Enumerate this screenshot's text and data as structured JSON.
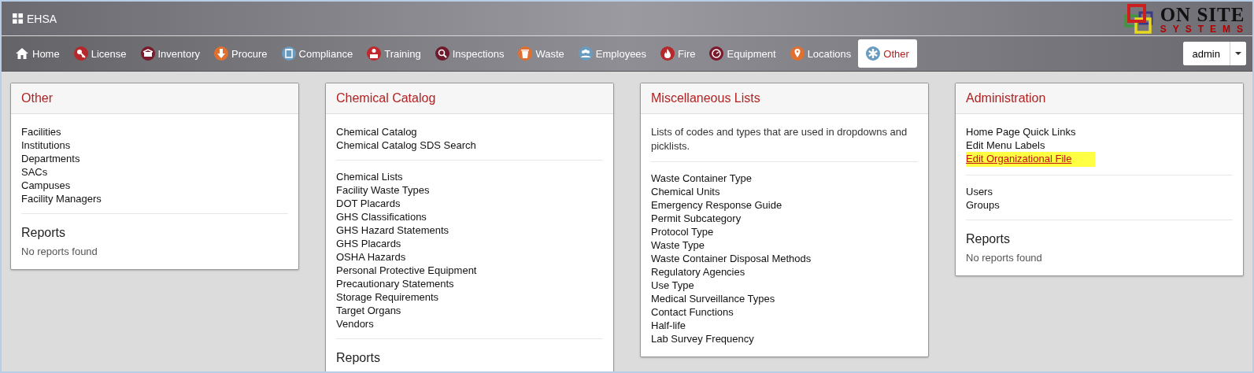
{
  "app": {
    "title": "EHSA"
  },
  "logo": {
    "line_1": "ON SITE",
    "line_2": "SYSTEMS"
  },
  "nav": [
    {
      "label": "Home",
      "color": "#ffffff",
      "selected": false
    },
    {
      "label": "License",
      "color": "#b5282b",
      "selected": false
    },
    {
      "label": "Inventory",
      "color": "#7a1a2c",
      "selected": false
    },
    {
      "label": "Procure",
      "color": "#e07030",
      "selected": false
    },
    {
      "label": "Compliance",
      "color": "#6a9cc0",
      "selected": false
    },
    {
      "label": "Training",
      "color": "#c0282e",
      "selected": false
    },
    {
      "label": "Inspections",
      "color": "#6e1a2c",
      "selected": false
    },
    {
      "label": "Waste",
      "color": "#e07030",
      "selected": false
    },
    {
      "label": "Employees",
      "color": "#6a9cc0",
      "selected": false
    },
    {
      "label": "Fire",
      "color": "#b5282b",
      "selected": false
    },
    {
      "label": "Equipment",
      "color": "#7a1a2c",
      "selected": false
    },
    {
      "label": "Locations",
      "color": "#e07030",
      "selected": false
    },
    {
      "label": "Other",
      "color": "#6a9cc0",
      "selected": true
    }
  ],
  "user_menu": {
    "label": "admin"
  },
  "panels": [
    {
      "title": "Other",
      "blocks": [
        {
          "kind": "links",
          "items": [
            {
              "label": "Facilities",
              "highlighted": false
            },
            {
              "label": "Institutions",
              "highlighted": false
            },
            {
              "label": "Departments",
              "highlighted": false
            },
            {
              "label": "SACs",
              "highlighted": false
            },
            {
              "label": "Campuses",
              "highlighted": false
            },
            {
              "label": "Facility Managers",
              "highlighted": false
            }
          ]
        },
        {
          "kind": "heading",
          "text": "Reports"
        },
        {
          "kind": "note",
          "text": "No reports found"
        }
      ]
    },
    {
      "title": "Chemical Catalog",
      "blocks": [
        {
          "kind": "links",
          "items": [
            {
              "label": "Chemical Catalog",
              "highlighted": false
            },
            {
              "label": "Chemical Catalog SDS Search",
              "highlighted": false
            }
          ]
        },
        {
          "kind": "links",
          "items": [
            {
              "label": "Chemical Lists",
              "highlighted": false
            },
            {
              "label": "Facility Waste Types",
              "highlighted": false
            },
            {
              "label": "DOT Placards",
              "highlighted": false
            },
            {
              "label": "GHS Classifications",
              "highlighted": false
            },
            {
              "label": "GHS Hazard Statements",
              "highlighted": false
            },
            {
              "label": "GHS Placards",
              "highlighted": false
            },
            {
              "label": "OSHA Hazards",
              "highlighted": false
            },
            {
              "label": "Personal Protective Equipment",
              "highlighted": false
            },
            {
              "label": "Precautionary Statements",
              "highlighted": false
            },
            {
              "label": "Storage Requirements",
              "highlighted": false
            },
            {
              "label": "Target Organs",
              "highlighted": false
            },
            {
              "label": "Vendors",
              "highlighted": false
            }
          ]
        },
        {
          "kind": "heading",
          "text": "Reports"
        }
      ]
    },
    {
      "title": "Miscellaneous Lists",
      "blocks": [
        {
          "kind": "description",
          "text": "Lists of codes and types that are used in dropdowns and picklists."
        },
        {
          "kind": "links",
          "items": [
            {
              "label": "Waste Container Type",
              "highlighted": false
            },
            {
              "label": "Chemical Units",
              "highlighted": false
            },
            {
              "label": "Emergency Response Guide",
              "highlighted": false
            },
            {
              "label": "Permit Subcategory",
              "highlighted": false
            },
            {
              "label": "Protocol Type",
              "highlighted": false
            },
            {
              "label": "Waste Type",
              "highlighted": false
            },
            {
              "label": "Waste Container Disposal Methods",
              "highlighted": false
            },
            {
              "label": "Regulatory Agencies",
              "highlighted": false
            },
            {
              "label": "Use Type",
              "highlighted": false
            },
            {
              "label": "Medical Surveillance Types",
              "highlighted": false
            },
            {
              "label": "Contact Functions",
              "highlighted": false
            },
            {
              "label": "Half-life",
              "highlighted": false
            },
            {
              "label": "Lab Survey Frequency",
              "highlighted": false
            }
          ]
        }
      ]
    },
    {
      "title": "Administration",
      "blocks": [
        {
          "kind": "links",
          "items": [
            {
              "label": "Home Page Quick Links",
              "highlighted": false
            },
            {
              "label": "Edit Menu Labels",
              "highlighted": false
            },
            {
              "label": "Edit Organizational File",
              "highlighted": true
            }
          ]
        },
        {
          "kind": "links",
          "items": [
            {
              "label": "Users",
              "highlighted": false
            },
            {
              "label": "Groups",
              "highlighted": false
            }
          ]
        },
        {
          "kind": "heading",
          "text": "Reports"
        },
        {
          "kind": "note",
          "text": "No reports found"
        }
      ]
    }
  ]
}
